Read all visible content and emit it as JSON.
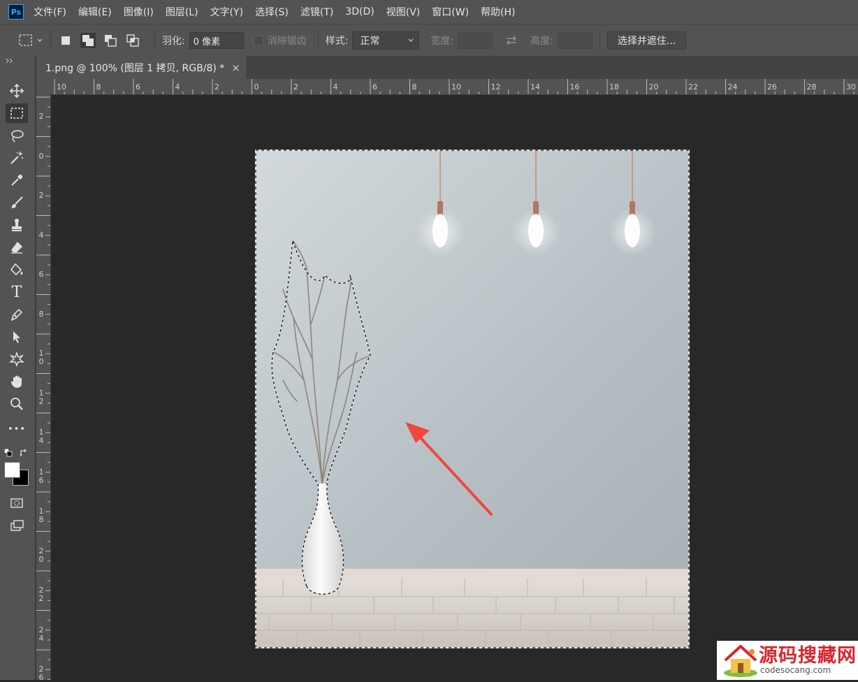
{
  "app": {
    "logo": "Ps",
    "accent": "#31a8ff"
  },
  "menu": [
    "文件(F)",
    "编辑(E)",
    "图像(I)",
    "图层(L)",
    "文字(Y)",
    "选择(S)",
    "滤镜(T)",
    "3D(D)",
    "视图(V)",
    "窗口(W)",
    "帮助(H)"
  ],
  "options": {
    "feather_label": "羽化:",
    "feather_value": "0 像素",
    "antialias_label": "消除锯齿",
    "style_label": "样式:",
    "style_value": "正常",
    "width_label": "宽度:",
    "height_label": "高度:",
    "select_mask_button": "选择并遮住..."
  },
  "document_tab": {
    "title": "1.png @ 100% (图层 1 拷贝, RGB/8) *",
    "close": "×"
  },
  "rulers": {
    "horizontal": [
      "10",
      "8",
      "6",
      "4",
      "2",
      "0",
      "2",
      "4",
      "6",
      "8",
      "10",
      "12",
      "14",
      "16",
      "18",
      "20",
      "22",
      "24",
      "26",
      "28",
      "30"
    ],
    "vertical": [
      "2",
      "0",
      "2",
      "4",
      "6",
      "8",
      "10",
      "12",
      "14",
      "16",
      "18",
      "20",
      "22",
      "24",
      "26"
    ]
  },
  "tools": [
    "move-tool",
    "rect-marquee-tool",
    "lasso-tool",
    "magic-wand-tool",
    "eyedropper-tool",
    "brush-tool",
    "stamp-tool",
    "eraser-tool",
    "paint-bucket-tool",
    "type-tool",
    "pen-tool",
    "path-select-tool",
    "shape-tool",
    "hand-tool",
    "zoom-tool",
    "more-tools"
  ],
  "type_tool_glyph": "T",
  "more_tools_glyph": "•••",
  "watermark": {
    "title": "源码搜藏网",
    "url": "codesocang.com"
  },
  "colors": {
    "arrow": "#f2463e",
    "wall": "#b9c4c8",
    "floor": "#d9d3cc"
  }
}
